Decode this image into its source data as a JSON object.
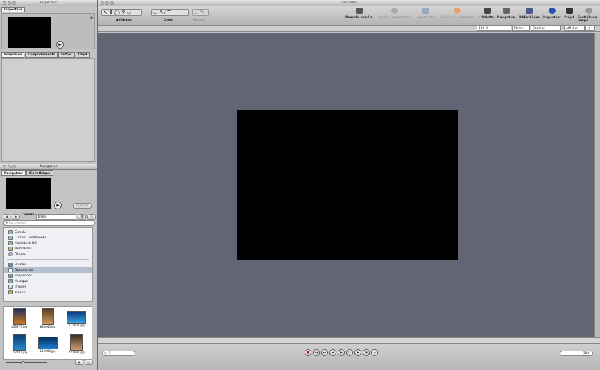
{
  "inspector": {
    "title": "Inspecteur",
    "tab": "Inspecteur",
    "tabs": [
      "Propriétés",
      "Comportements",
      "Filtres",
      "Objet"
    ]
  },
  "navigator": {
    "title": "Navigateur",
    "tabs": [
      "Navigateur",
      "Bibliothèque"
    ],
    "import_label": "Importer",
    "path_label": "Chemin :",
    "path_value": "brma",
    "search_placeholder": "Rechercher",
    "sources": [
      "Classic",
      "Current Guidebooks",
      "Macintosh HD",
      "MediaBank",
      "Réseau"
    ],
    "places": [
      "Bureau",
      "Documents",
      "Séquences",
      "Musique",
      "Images",
      "steven"
    ],
    "thumbnails": [
      "829877.jpg",
      "831045.jpg",
      "112004.jpg",
      "112081.jpg",
      "112004.jpg",
      "421093.jpg"
    ]
  },
  "canvas": {
    "title": "Sans titre",
    "tools_left": [
      "Affichage",
      "Créer",
      "Masque"
    ],
    "tools_right": [
      "Nouvelle caméra",
      "Ajouter comportement",
      "Ajouter filtre",
      "Générer des particules",
      "Réplicateur"
    ],
    "panels": [
      "Palette",
      "Navigateur",
      "Bibliothèque",
      "Inspecteur",
      "Projet",
      "Contrôle du temps"
    ],
    "zoom": "100 %",
    "view": "Pleine",
    "channel": "Couleur",
    "display": "Afficher",
    "frame": "1",
    "end_frame": "300"
  },
  "colors": {
    "canvas_bg": "#626674",
    "frame": "#000000"
  }
}
